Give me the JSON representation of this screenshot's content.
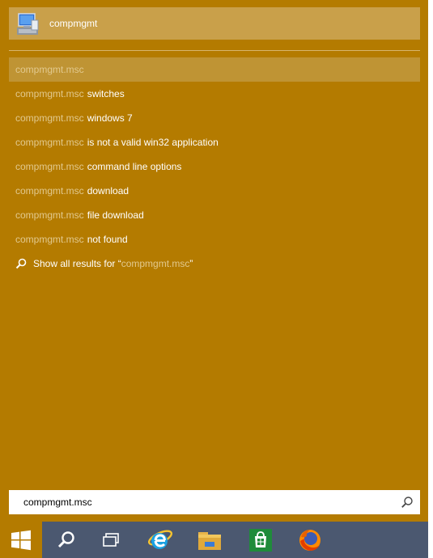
{
  "top_result": {
    "label": "compmgmt",
    "icon": "computer-management-icon"
  },
  "query": "compmgmt.msc",
  "suggestions": [
    {
      "rest": ""
    },
    {
      "rest": "switches"
    },
    {
      "rest": "windows 7"
    },
    {
      "rest": "is not a valid win32 application"
    },
    {
      "rest": "command line options"
    },
    {
      "rest": "download"
    },
    {
      "rest": "file download"
    },
    {
      "rest": "not found"
    }
  ],
  "show_all": {
    "prefix": "Show all results for “",
    "query": "compmgmt.msc",
    "suffix": "”"
  },
  "search_box": {
    "value": "compmgmt.msc"
  },
  "taskbar": {
    "items": [
      "start-icon",
      "search-icon",
      "task-view-icon",
      "internet-explorer-icon",
      "file-explorer-icon",
      "store-icon",
      "firefox-icon"
    ]
  },
  "colors": {
    "accent": "#b47b00",
    "taskbar": "#4b5870",
    "highlight": "#bf9434",
    "top_result_bg": "#c9a04a"
  }
}
